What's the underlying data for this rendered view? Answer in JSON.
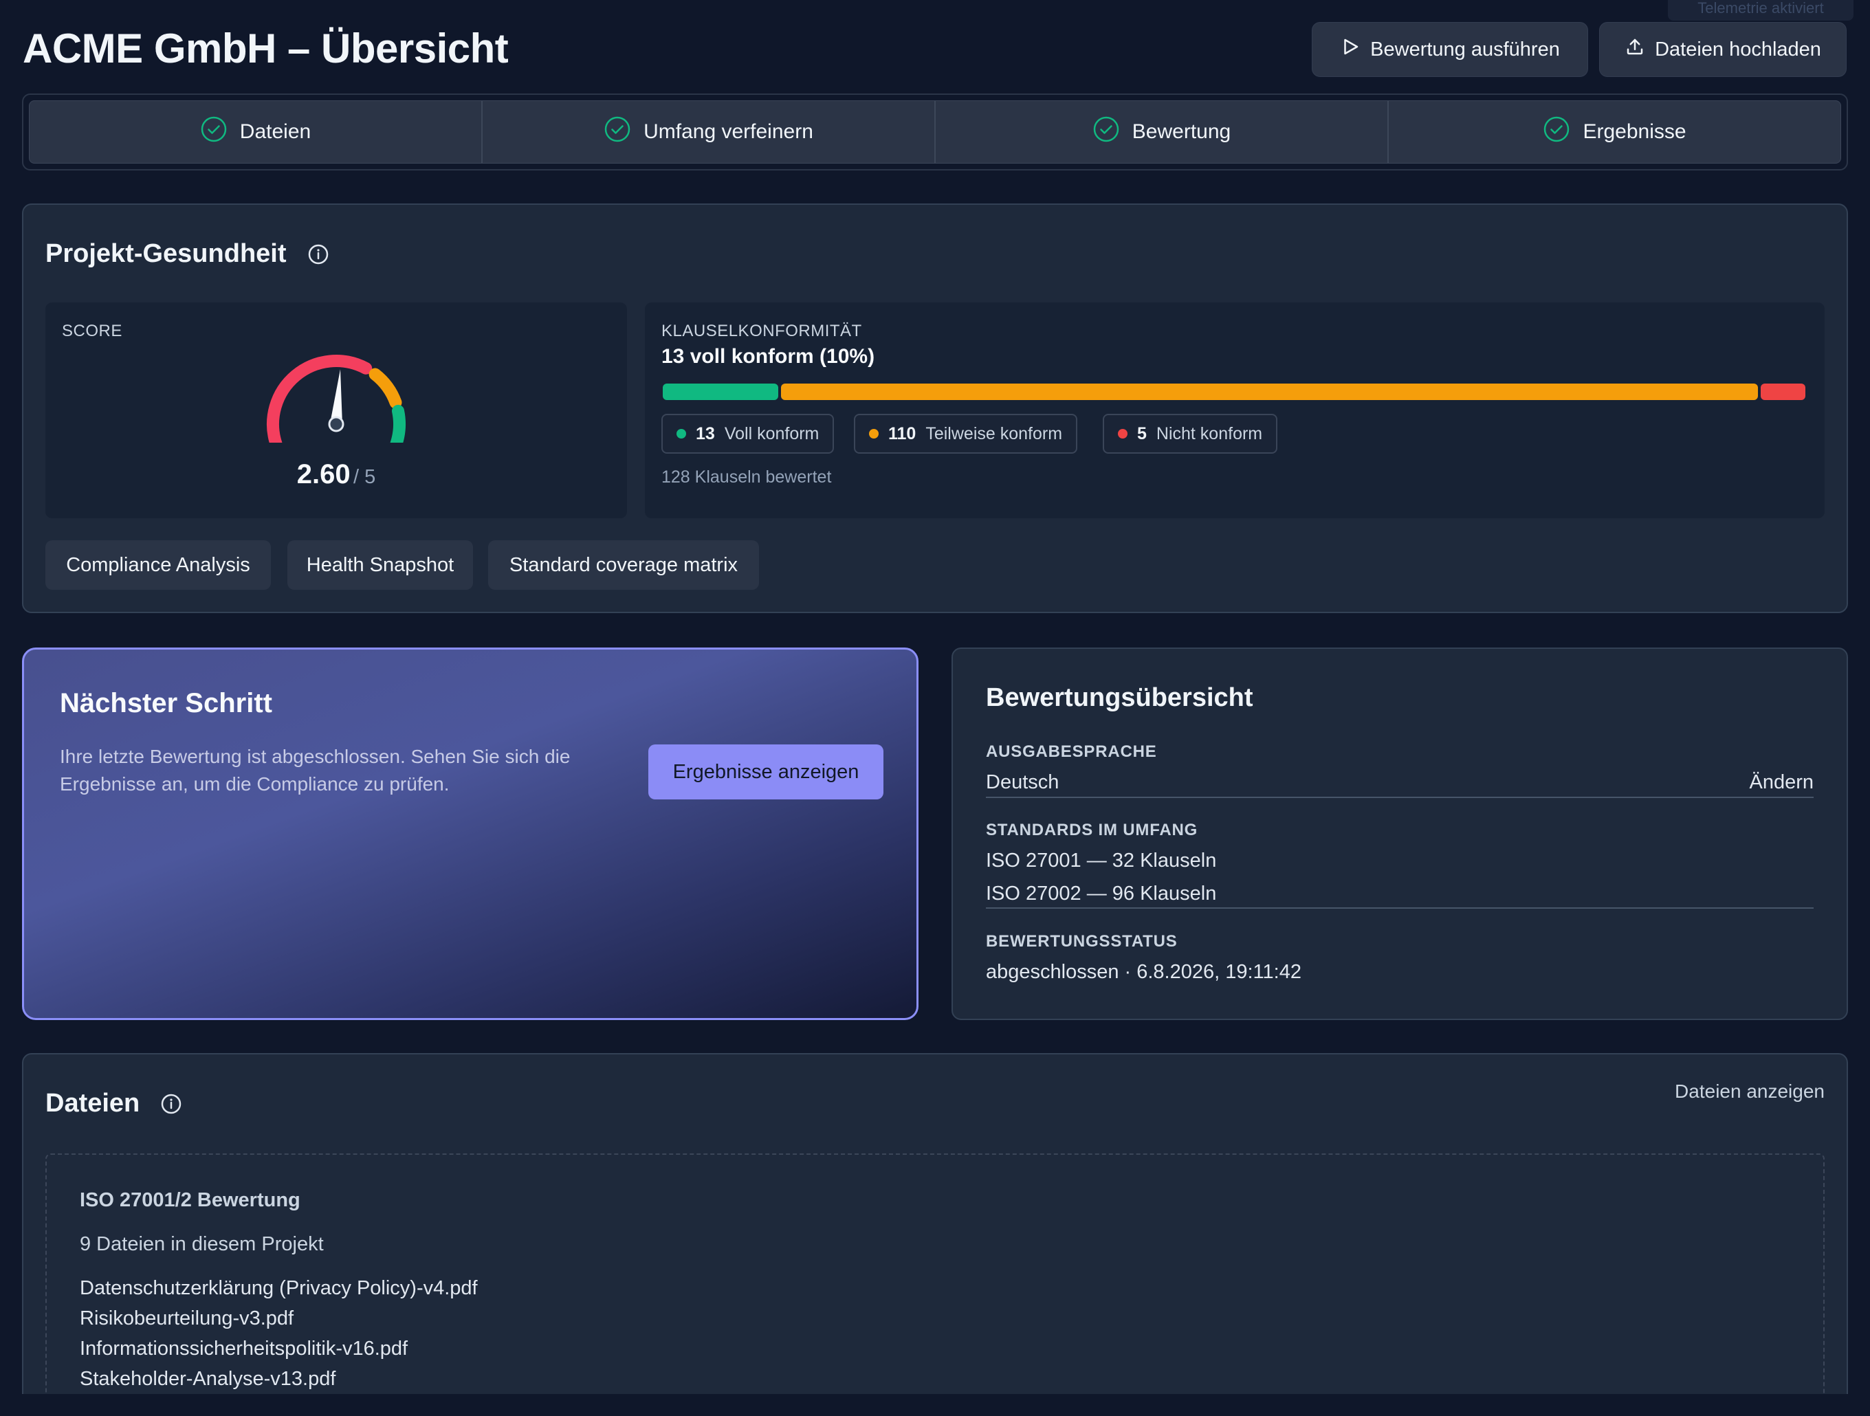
{
  "header": {
    "title": "ACME GmbH – Übersicht",
    "faint_tag": "Telemetrie aktiviert",
    "run_button": "Bewertung ausführen",
    "upload_button": "Dateien hochladen"
  },
  "stepper": {
    "steps": [
      {
        "label": "Dateien",
        "done": true
      },
      {
        "label": "Umfang verfeinern",
        "done": true
      },
      {
        "label": "Bewertung",
        "done": true
      },
      {
        "label": "Ergebnisse",
        "done": true
      }
    ]
  },
  "health": {
    "title": "Projekt-Gesundheit",
    "score_label": "SCORE",
    "score_value": "2.60",
    "score_max": "/ 5",
    "score_fraction": 0.52,
    "conformity_label": "KLAUSELKONFORMITÄT",
    "conformity_summary": "13 voll konform (10%)",
    "bar_segments": [
      {
        "value": 13,
        "color": "#10b981"
      },
      {
        "value": 110,
        "color": "#f59e0b"
      },
      {
        "value": 5,
        "color": "#ef4444"
      }
    ],
    "pills": [
      {
        "count": "13",
        "label": "Voll konform",
        "color": "#10b981"
      },
      {
        "count": "110",
        "label": "Teilweise konform",
        "color": "#f59e0b"
      },
      {
        "count": "5",
        "label": "Nicht konform",
        "color": "#ef4444"
      }
    ],
    "clauses_total": "128 Klauseln bewertet",
    "chips": [
      "Compliance Analysis",
      "Health Snapshot",
      "Standard coverage matrix"
    ]
  },
  "next_step": {
    "title": "Nächster Schritt",
    "text": "Ihre letzte Bewertung ist abgeschlossen. Sehen Sie sich die Ergebnisse an, um die Compliance zu prüfen.",
    "button": "Ergebnisse anzeigen"
  },
  "overview": {
    "title": "Bewertungsübersicht",
    "language_label": "AUSGABESPRACHE",
    "language_value": "Deutsch",
    "language_change": "Ändern",
    "standards_label": "STANDARDS IM UMFANG",
    "standards": [
      "ISO 27001 — 32 Klauseln",
      "ISO 27002 — 96 Klauseln"
    ],
    "status_label": "BEWERTUNGSSTATUS",
    "status_value": "abgeschlossen · 6.8.2026, 19:11:42"
  },
  "files": {
    "title": "Dateien",
    "view_link": "Dateien anzeigen",
    "project_name": "ISO 27001/2 Bewertung",
    "count_text": "9 Dateien in diesem Projekt",
    "list": [
      "Datenschutzerklärung (Privacy Policy)-v4.pdf",
      "Risikobeurteilung-v3.pdf",
      "Informationssicherheitspolitik-v16.pdf",
      "Stakeholder-Analyse-v13.pdf"
    ]
  },
  "colors": {
    "accent": "#8b8cf6",
    "success": "#10b981",
    "warning": "#f59e0b",
    "danger": "#ef4444"
  }
}
